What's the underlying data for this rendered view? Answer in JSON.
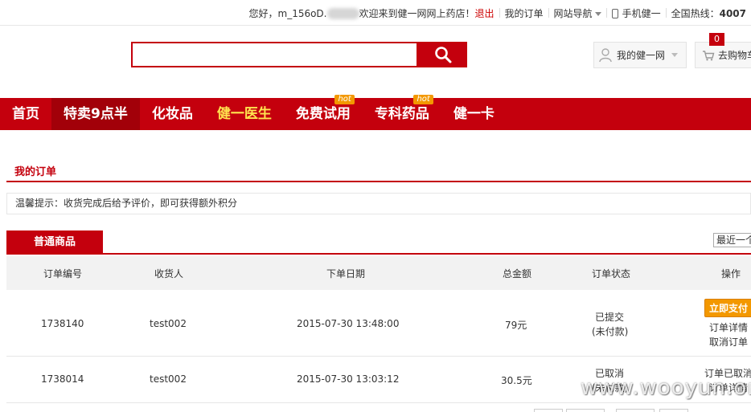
{
  "topbar": {
    "greeting": "您好，",
    "username": "m_156oD.",
    "welcome": "欢迎来到健一网网上药店！",
    "logout": "退出",
    "my_orders": "我的订单",
    "site_nav": "网站导航",
    "mobile": "手机健一",
    "hotline": "全国热线：",
    "hotline_number": "4007"
  },
  "header": {
    "search_value": "",
    "my_account": "我的健一网",
    "cart_count": "0",
    "cart_label": "去购物车"
  },
  "nav": {
    "items": [
      {
        "label": "首页"
      },
      {
        "label": "特卖9点半"
      },
      {
        "label": "化妆品"
      },
      {
        "label": "健一医生"
      },
      {
        "label": "免费试用",
        "badge": "hot"
      },
      {
        "label": "专科药品",
        "badge": "hot"
      },
      {
        "label": "健一卡"
      }
    ]
  },
  "orders": {
    "title": "我的订单",
    "tip": "温馨提示：收货完成后给予评价，即可获得额外积分",
    "tab": "普通商品",
    "period": "最近一个月",
    "columns": [
      "订单编号",
      "收货人",
      "下单日期",
      "总金额",
      "订单状态",
      "操作"
    ],
    "rows": [
      {
        "id": "1738140",
        "receiver": "test002",
        "date": "2015-07-30 13:48:00",
        "amount": "79元",
        "status": "已提交",
        "status_sub": "(未付款)",
        "action_pay": "立即支付",
        "action_detail": "订单详情",
        "action_cancel": "取消订单"
      },
      {
        "id": "1738014",
        "receiver": "test002",
        "date": "2015-07-30 13:03:12",
        "amount": "30.5元",
        "status": "已取消",
        "status_sub": "(未付款)",
        "action_note": "订单已取消",
        "action_detail": "订单详情"
      }
    ]
  },
  "watermark": "www.wooyun.org",
  "colors": {
    "brand_red": "#c4000d",
    "link_blue": "#1a66b3",
    "hot_orange": "#f39800"
  }
}
